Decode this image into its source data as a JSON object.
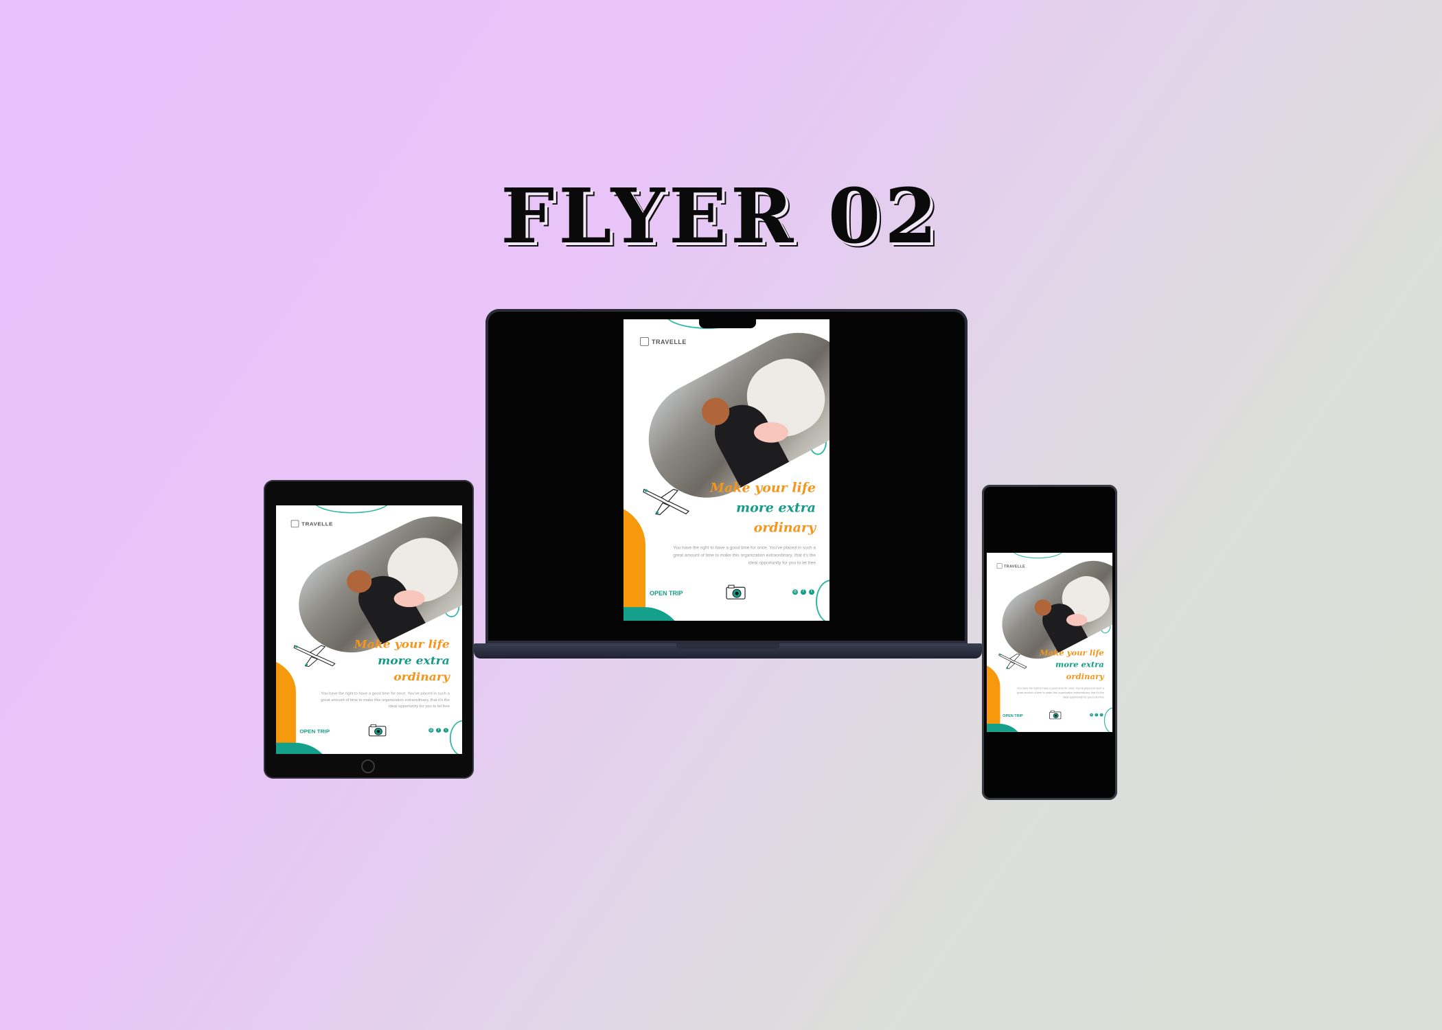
{
  "title": "FLYER 02",
  "flyer": {
    "brand": "TRAVELLE",
    "headline": [
      "Make your life",
      "more extra",
      "ordinary"
    ],
    "body": "You have the right to have a good time for once. You've placed in such a great amount of time to make this organization extraordinary, that it's the ideal opportunity for you to let free",
    "cta": "OPEN TRIP",
    "social_icons": [
      "instagram-icon",
      "facebook-icon",
      "twitter-icon"
    ],
    "colors": {
      "orange": "#f5951a",
      "teal": "#149c88",
      "pink": "#f8c6bd"
    }
  }
}
